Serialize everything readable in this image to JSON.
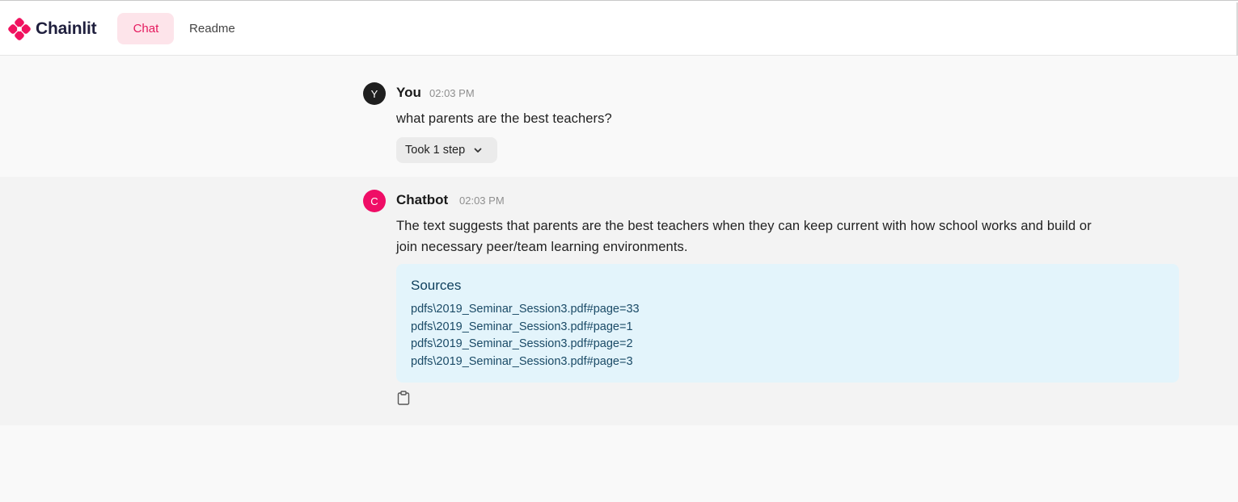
{
  "header": {
    "brand": "Chainlit",
    "tabs": [
      {
        "label": "Chat",
        "active": true
      },
      {
        "label": "Readme",
        "active": false
      }
    ]
  },
  "messages": {
    "user": {
      "avatar_letter": "Y",
      "author": "You",
      "time": "02:03 PM",
      "text": "what parents are the best teachers?",
      "step_label": "Took 1 step"
    },
    "bot": {
      "avatar_letter": "C",
      "author": "Chatbot",
      "time": "02:03 PM",
      "text_line1": "The text suggests that parents are the best teachers when they can keep current with how school works and build or",
      "text_line2": "join necessary peer/team learning environments.",
      "sources_title": "Sources",
      "sources": [
        "pdfs\\2019_Seminar_Session3.pdf#page=33",
        "pdfs\\2019_Seminar_Session3.pdf#page=1",
        "pdfs\\2019_Seminar_Session3.pdf#page=2",
        "pdfs\\2019_Seminar_Session3.pdf#page=3"
      ]
    }
  },
  "colors": {
    "brand_pink": "#e5195e",
    "active_tab_bg": "#fde4ea",
    "user_avatar": "#1f1f1f",
    "bot_avatar": "#ef0d66",
    "sources_bg": "#e3f4fb"
  },
  "icons": {
    "logo": "chainlit-logo-icon",
    "step_toggle": "chevron-down-icon",
    "copy": "clipboard-icon"
  }
}
